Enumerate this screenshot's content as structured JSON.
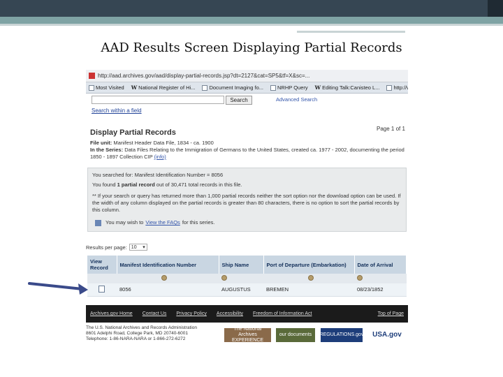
{
  "slide": {
    "title": "AAD Results Screen Displaying Partial Records"
  },
  "browser": {
    "url": "http://aad.archives.gov/aad/display-partial-records.jsp?dt=2127&cat=SP5&tf=X&sc=...",
    "bookmarks": [
      {
        "label": "Most Visited",
        "icon": "page-icon"
      },
      {
        "label": "National Register of Hi...",
        "icon": "wikipedia-icon"
      },
      {
        "label": "Document Imaging fo...",
        "icon": "page-icon"
      },
      {
        "label": "NRHP Query",
        "icon": "page-icon"
      },
      {
        "label": "Editing Talk:Canisteo L...",
        "icon": "wikipedia-icon"
      },
      {
        "label": "http://www.erie.gov/a...",
        "icon": "page-icon"
      }
    ]
  },
  "search": {
    "button_label": "Search",
    "advanced_label": "Advanced Search",
    "within_field_label": "Search within a field"
  },
  "page": {
    "title": "Display Partial Records",
    "page_indicator": "Page 1 of 1",
    "file_unit_label": "File unit:",
    "file_unit_value": "Manifest Header Data File, 1834 - ca. 1900",
    "series_label": "In the Series:",
    "series_value": "Data Files Relating to the Immigration of Germans to the United States, created ca. 1977 - 2002, documenting the period 1850 - 1897",
    "collection_label": "Collection CIP",
    "info_link": "(info)"
  },
  "search_panel": {
    "searched_for": "You searched for: Manifest Identification Number = 8056",
    "found_prefix": "You found",
    "found_bold": "1 partial record",
    "found_suffix": "out of 30,471 total records in this file.",
    "note": "** If your search or query has returned more than 1,000 partial records neither the sort option nor the download option can be used. If the width of any column displayed on the partial records is greater than 80 characters, there is no option to sort the partial records by this column.",
    "faq_prefix": "You may wish to",
    "faq_link": "View the FAQs",
    "faq_suffix": "for this series."
  },
  "results": {
    "per_page_label": "Results per page:",
    "per_page_value": "10",
    "columns": [
      "View Record",
      "Manifest Identification Number",
      "Ship Name",
      "Port of Departure (Embarkation)",
      "Date of Arrival"
    ],
    "rows": [
      {
        "id": "8056",
        "ship": "AUGUSTUS",
        "port": "BREMEN",
        "date": "08/23/1852"
      }
    ]
  },
  "footer": {
    "links": [
      "Archives.gov Home",
      "Contact Us",
      "Privacy Policy",
      "Accessibility",
      "Freedom of Information Act"
    ],
    "top_link": "Top of Page",
    "address_line1": "The U.S. National Archives and Records Administration",
    "address_line2": "8601 Adelphi Road, College Park, MD 20740-6001",
    "address_line3": "Telephone: 1-86-NARA-NARA or 1-866-272-6272",
    "logos": [
      "The National Archives EXPERIENCE",
      "our documents",
      "REGULATIONS.gov",
      "USA.gov"
    ]
  },
  "colors": {
    "table_header_bg": "#c9d6e2",
    "footer_bg": "#1b1b1b",
    "arrow": "#3a4a8a"
  }
}
